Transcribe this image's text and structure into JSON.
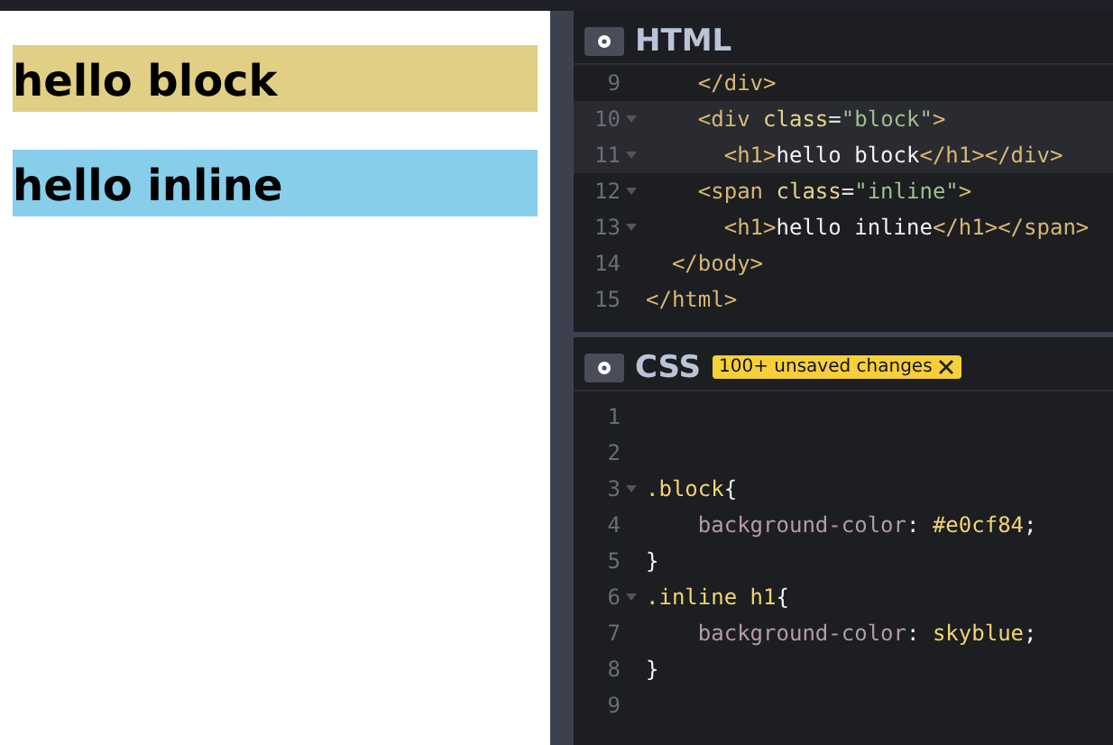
{
  "preview": {
    "blocks": [
      {
        "text": "hello block",
        "color": "#e0cf84"
      },
      {
        "text": "hello inline",
        "color": "#87ceeb"
      }
    ]
  },
  "html_panel": {
    "title": "HTML",
    "lines": [
      {
        "number": "9",
        "fold": false,
        "selected": false,
        "tokens": [
          {
            "kind": "tag",
            "text": "    </div>"
          }
        ]
      },
      {
        "number": "10",
        "fold": true,
        "selected": true,
        "tokens": [
          {
            "kind": "tag",
            "text": "    <div "
          },
          {
            "kind": "attr",
            "text": "class"
          },
          {
            "kind": "plain",
            "text": "="
          },
          {
            "kind": "string",
            "text": "\"block\""
          },
          {
            "kind": "tag",
            "text": ">"
          }
        ]
      },
      {
        "number": "11",
        "fold": true,
        "selected": true,
        "tokens": [
          {
            "kind": "tag",
            "text": "      <h1>"
          },
          {
            "kind": "text",
            "text": "hello block"
          },
          {
            "kind": "tag",
            "text": "</h1></div>"
          }
        ]
      },
      {
        "number": "12",
        "fold": true,
        "selected": false,
        "tokens": [
          {
            "kind": "tag",
            "text": "    <span "
          },
          {
            "kind": "attr",
            "text": "class"
          },
          {
            "kind": "plain",
            "text": "="
          },
          {
            "kind": "string",
            "text": "\"inline\""
          },
          {
            "kind": "tag",
            "text": ">"
          }
        ]
      },
      {
        "number": "13",
        "fold": true,
        "selected": false,
        "tokens": [
          {
            "kind": "tag",
            "text": "      <h1>"
          },
          {
            "kind": "text",
            "text": "hello inline"
          },
          {
            "kind": "tag",
            "text": "</h1></span>"
          }
        ]
      },
      {
        "number": "14",
        "fold": false,
        "selected": false,
        "tokens": [
          {
            "kind": "tag",
            "text": "  </body>"
          }
        ]
      },
      {
        "number": "15",
        "fold": false,
        "selected": false,
        "tokens": [
          {
            "kind": "tag",
            "text": "</html>"
          }
        ]
      }
    ]
  },
  "css_panel": {
    "title": "CSS",
    "badge": "100+ unsaved changes",
    "lines": [
      {
        "number": "1",
        "fold": false,
        "selected": false
      },
      {
        "number": "2",
        "fold": false,
        "selected": false
      },
      {
        "number": "3",
        "fold": true,
        "selected": false,
        "tokens": [
          {
            "kind": "selector",
            "text": ".block"
          },
          {
            "kind": "text",
            "text": "{"
          }
        ]
      },
      {
        "number": "4",
        "fold": false,
        "selected": false,
        "tokens": [
          {
            "kind": "prop",
            "text": "    background-color"
          },
          {
            "kind": "text",
            "text": ": "
          },
          {
            "kind": "value",
            "text": "#e0cf84"
          },
          {
            "kind": "text",
            "text": ";"
          }
        ]
      },
      {
        "number": "5",
        "fold": false,
        "selected": false,
        "tokens": [
          {
            "kind": "text",
            "text": "}"
          }
        ]
      },
      {
        "number": "6",
        "fold": true,
        "selected": false,
        "tokens": [
          {
            "kind": "selector",
            "text": ".inline h1"
          },
          {
            "kind": "text",
            "text": "{"
          }
        ]
      },
      {
        "number": "7",
        "fold": false,
        "selected": false,
        "tokens": [
          {
            "kind": "prop",
            "text": "    background-color"
          },
          {
            "kind": "text",
            "text": ": "
          },
          {
            "kind": "value",
            "text": "skyblue"
          },
          {
            "kind": "text",
            "text": ";"
          }
        ]
      },
      {
        "number": "8",
        "fold": false,
        "selected": false,
        "tokens": [
          {
            "kind": "text",
            "text": "}"
          }
        ]
      },
      {
        "number": "9",
        "fold": false,
        "selected": false
      }
    ]
  }
}
